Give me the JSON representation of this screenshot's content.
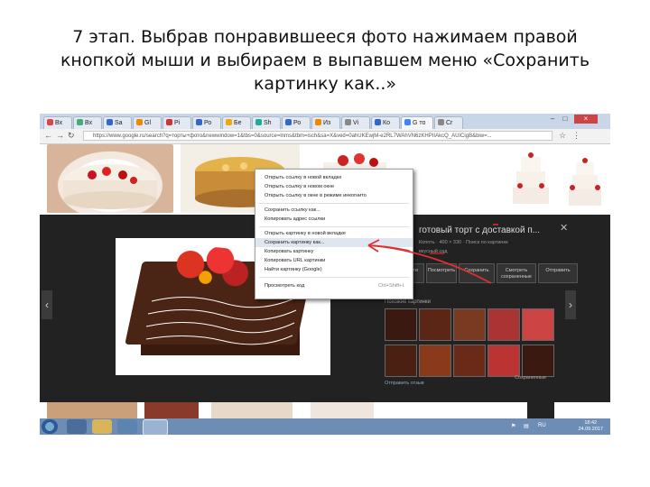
{
  "caption": {
    "line1": "7 этап. Выбрав понравившееся фото нажимаем правой",
    "line2": "кнопкой мыши и выбираем в выпавшем меню «Сохранить",
    "line3": "картинку как..»"
  },
  "browser": {
    "tabs": [
      {
        "label": "Вх",
        "color": "#d44"
      },
      {
        "label": "Bx",
        "color": "#4a7"
      },
      {
        "label": "Sa",
        "color": "#36c"
      },
      {
        "label": "Gl",
        "color": "#e80"
      },
      {
        "label": "Pi",
        "color": "#c33"
      },
      {
        "label": "Ро",
        "color": "#36c"
      },
      {
        "label": "Бе",
        "color": "#ea0"
      },
      {
        "label": "Sh",
        "color": "#2a9"
      },
      {
        "label": "Ро",
        "color": "#36c"
      },
      {
        "label": "Из",
        "color": "#e80"
      },
      {
        "label": "Vi",
        "color": "#888"
      },
      {
        "label": "Ко",
        "color": "#36c"
      },
      {
        "label": "G то",
        "color": "#4285f4"
      },
      {
        "label": "Cr",
        "color": "#888"
      }
    ],
    "url": "https://www.google.ru/search?q=торты+фото&newwindow=1&tbs=0&source=lnms&tbm=isch&sa=X&ved=0ahUKEwjM-e2RL7WAhVN6zKHPIIAkcQ_AUICigB&biw=..."
  },
  "context_menu": {
    "items": [
      "Открыть ссылку в новой вкладке",
      "Открыть ссылку в новом окне",
      "Открыть ссылку в окне в режиме инкогнито",
      "Сохранить ссылку как...",
      "Копировать адрес ссылки",
      "Открыть картинку в новой вкладке",
      "Сохранить картинку как...",
      "Копировать картинку",
      "Копировать URL картинки",
      "Найти картинку (Google)",
      "Просмотреть код"
    ],
    "inspect_shortcut": "Ctrl+Shift+I"
  },
  "viewer": {
    "title": "готовый торт с доставкой п...",
    "meta": "Копоть · 400 × 330 · Поиск по картинке",
    "sub": "вкусный сад",
    "buttons": [
      "Перейти",
      "Посмотреть",
      "Сохранить",
      "Смотреть сохраненные",
      "Отправить"
    ],
    "similar_label": "Похожие картинки",
    "more_link": "Отправить отзыв",
    "similar_more": "Сохраненные"
  },
  "taskbar": {
    "time": "18:42",
    "date": "24.09.2017",
    "lang": "RU"
  }
}
